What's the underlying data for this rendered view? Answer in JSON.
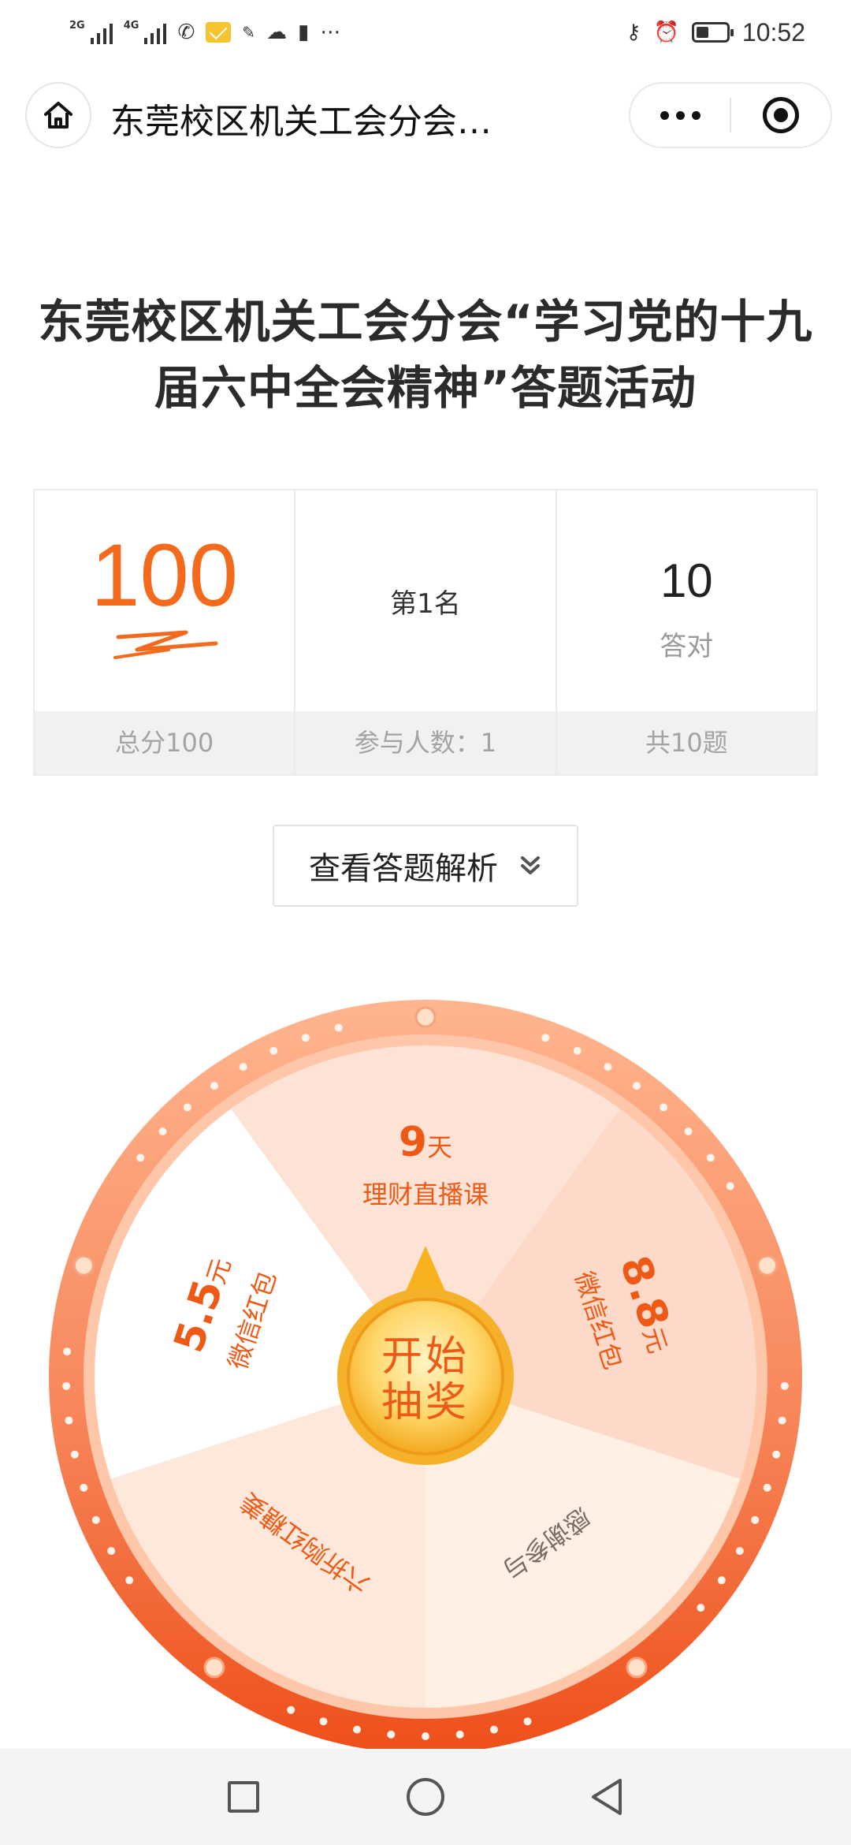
{
  "status_bar": {
    "net1": "2G",
    "net2": "4G",
    "time": "10:52",
    "icons": [
      "signal-icon",
      "signal-icon",
      "missed-call-icon",
      "mail-icon",
      "study-app-icon",
      "cloud-icon",
      "sim-alert-icon",
      "more-dots-icon",
      "key-icon",
      "alarm-icon",
      "battery-icon"
    ],
    "battery_level": 0.4
  },
  "title_bar": {
    "title": "东莞校区机关工会分会…"
  },
  "activity": {
    "title": "东莞校区机关工会分会“学习党的十九届六中全会精神”答题活动"
  },
  "score_panel": {
    "score": "100",
    "total_label": "总分100",
    "rank": "第1名",
    "participants": "参与人数：1",
    "correct_count": "10",
    "correct_label": "答对",
    "total_questions": "共10题"
  },
  "analysis_button": {
    "label": "查看答题解析"
  },
  "wheel": {
    "center_line1": "开始",
    "center_line2": "抽奖",
    "prizes": [
      {
        "amount": "9",
        "unit": "天",
        "name": "理财直播课"
      },
      {
        "amount": "8.8",
        "unit": "元",
        "name": "微信红包"
      },
      {
        "amount": "",
        "unit": "",
        "name": "感谢参与"
      },
      {
        "amount": "",
        "unit": "",
        "name": "六折购红糖姜"
      },
      {
        "amount": "5.5",
        "unit": "元",
        "name": "微信红包"
      }
    ],
    "colors": {
      "rim_outer": "#f0561f",
      "rim_inner": "#ffb08a",
      "text_accent": "#ee5a16",
      "center_gold": "#f7b72c"
    }
  },
  "nav_bar": {
    "icons": [
      "recent-apps-icon",
      "home-icon",
      "back-icon"
    ]
  }
}
